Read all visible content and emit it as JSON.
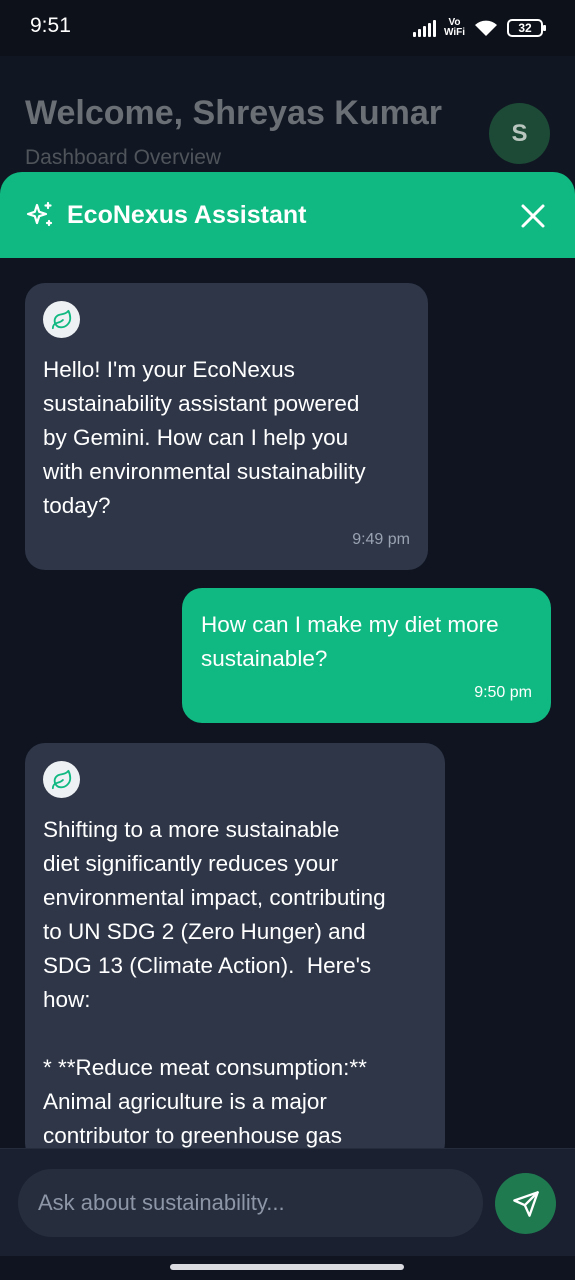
{
  "status_bar": {
    "time": "9:51",
    "vowifi_top": "Vo",
    "vowifi_bottom": "WiFi",
    "battery": "32"
  },
  "dashboard": {
    "title": "Welcome, Shreyas Kumar",
    "subtitle": "Dashboard Overview",
    "avatar_initial": "S"
  },
  "assistant": {
    "title": "EcoNexus Assistant",
    "accent_color": "#10b981",
    "messages": [
      {
        "role": "bot",
        "text": "Hello! I'm your EcoNexus\nsustainability assistant powered\nby Gemini. How can I help you\nwith environmental sustainability\ntoday?",
        "time": "9:49 pm"
      },
      {
        "role": "user",
        "text": "How can I make my diet more\nsustainable?",
        "time": "9:50 pm"
      },
      {
        "role": "bot",
        "text": "Shifting to a more sustainable\ndiet significantly reduces your\nenvironmental impact, contributing\nto UN SDG 2 (Zero Hunger) and\nSDG 13 (Climate Action).  Here's\nhow:\n\n* **Reduce meat consumption:**\nAnimal agriculture is a major\ncontributor to greenhouse gas"
      }
    ]
  },
  "input": {
    "placeholder": "Ask about sustainability...",
    "value": ""
  },
  "icons": {
    "sparkle": "sparkles-icon",
    "close": "close-icon",
    "leaf": "leaf-icon",
    "send": "send-icon"
  }
}
